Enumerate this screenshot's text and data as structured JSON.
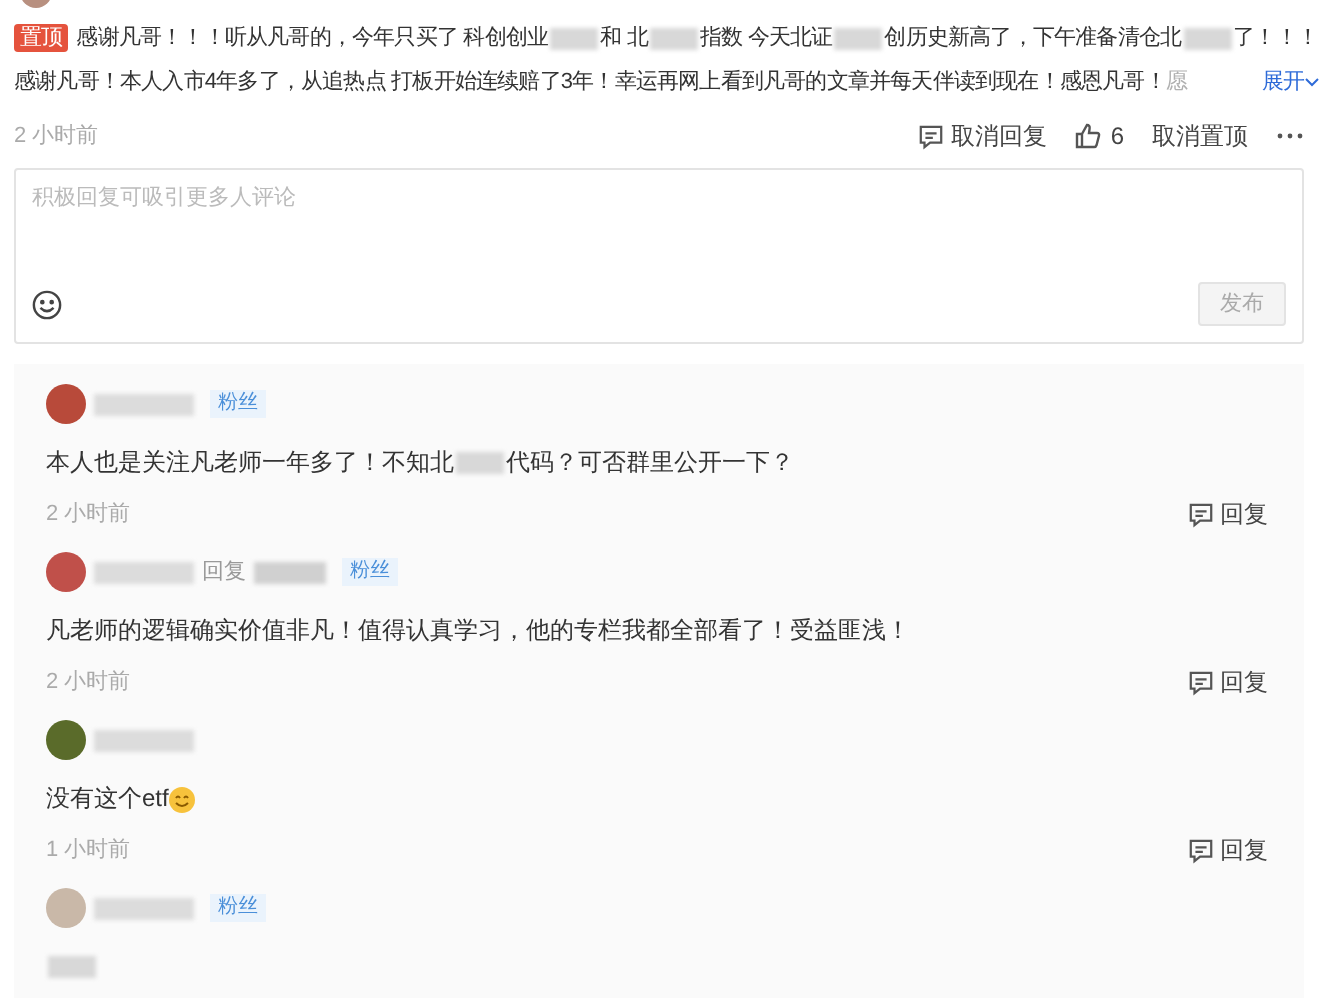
{
  "comment": {
    "badge": "置顶",
    "lines": [
      [
        {
          "kind": "text",
          "text": "感谢凡哥！！！听从凡哥的，今年只买了 科创创业"
        },
        {
          "kind": "redacted"
        },
        {
          "kind": "text",
          "text": "和 北"
        },
        {
          "kind": "redacted"
        },
        {
          "kind": "text",
          "text": "指数 今天北证"
        },
        {
          "kind": "redacted"
        },
        {
          "kind": "text",
          "text": "创历史新高了，下午准备清仓北"
        },
        {
          "kind": "redacted"
        },
        {
          "kind": "text",
          "text": "了！！！"
        }
      ],
      [
        {
          "kind": "text",
          "text": "感谢凡哥！本人入市4年多了，从追热点 打板开始连续赔了3年！幸运再网上看到凡哥的文章并每天伴读到现在！感恩凡哥！"
        },
        {
          "kind": "faded",
          "text": "愿"
        }
      ]
    ],
    "expand": "展开",
    "time": "2 小时前",
    "cancel_reply": "取消回复",
    "likes": "6",
    "liked": false,
    "cancel_pin": "取消置顶"
  },
  "reply_box": {
    "placeholder": "积极回复可吸引更多人评论",
    "submit": "发布"
  },
  "replies": [
    {
      "fan_badge": "粉丝",
      "body": [
        {
          "kind": "text",
          "text": "本人也是关注凡老师一年多了！不知北"
        },
        {
          "kind": "redacted"
        },
        {
          "kind": "text",
          "text": "代码？可否群里公开一下？"
        }
      ],
      "time": "2 小时前",
      "reply": "回复"
    },
    {
      "reply_label": "回复",
      "fan_badge": "粉丝",
      "body": [
        {
          "kind": "text",
          "text": "凡老师的逻辑确实价值非凡！值得认真学习，他的专栏我都全部看了！受益匪浅！"
        }
      ],
      "time": "2 小时前",
      "reply": "回复"
    },
    {
      "body": [
        {
          "kind": "text",
          "text": "没有这个etf"
        },
        {
          "kind": "emoji"
        }
      ],
      "time": "1 小时前",
      "reply": "回复"
    },
    {
      "fan_badge": "粉丝",
      "body": [
        {
          "kind": "redacted"
        }
      ]
    }
  ]
}
